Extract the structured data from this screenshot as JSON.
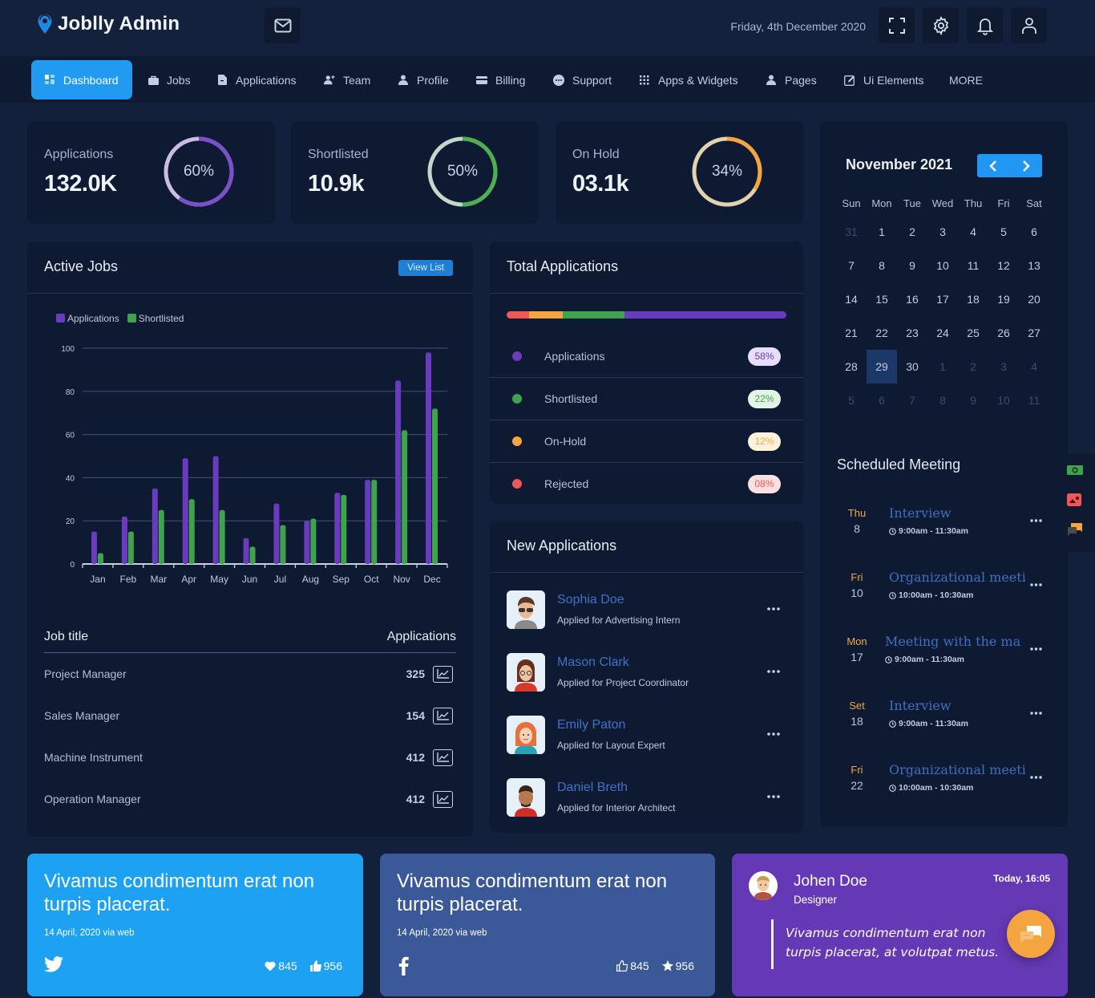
{
  "header": {
    "app_title": "Joblly Admin",
    "date": "Friday, 4th December 2020",
    "icons": [
      "mail-icon",
      "fullscreen-icon",
      "settings-icon",
      "bell-icon",
      "user-icon"
    ]
  },
  "nav": {
    "items": [
      {
        "label": "Dashboard",
        "icon": "dashboard-icon",
        "active": true
      },
      {
        "label": "Jobs",
        "icon": "briefcase-icon"
      },
      {
        "label": "Applications",
        "icon": "document-icon"
      },
      {
        "label": "Team",
        "icon": "add-user-icon"
      },
      {
        "label": "Profile",
        "icon": "person-icon"
      },
      {
        "label": "Billing",
        "icon": "credit-card-icon"
      },
      {
        "label": "Support",
        "icon": "chat-bubble-icon"
      },
      {
        "label": "Apps & Widgets",
        "icon": "grid-icon"
      },
      {
        "label": "Pages",
        "icon": "person-icon"
      },
      {
        "label": "Ui Elements",
        "icon": "edit-icon"
      },
      {
        "label": "MORE"
      }
    ]
  },
  "stats": [
    {
      "label": "Applications",
      "value": "132.0K",
      "percent_text": "60%",
      "percent": 60,
      "color": "#7b4fc9",
      "track": "#c9bde6"
    },
    {
      "label": "Shortlisted",
      "value": "10.9k",
      "percent_text": "50%",
      "percent": 50,
      "color": "#4caf50",
      "track": "#c6d6cb"
    },
    {
      "label": "On Hold",
      "value": "03.1k",
      "percent_text": "34%",
      "percent": 34,
      "color": "#f5a540",
      "track": "#e3d2b0"
    }
  ],
  "active_jobs": {
    "title": "Active Jobs",
    "view_list_label": "View List",
    "table": {
      "headers": [
        "Job title",
        "Applications"
      ],
      "rows": [
        {
          "title": "Project Manager",
          "count": "325"
        },
        {
          "title": "Sales Manager",
          "count": "154"
        },
        {
          "title": "Machine Instrument",
          "count": "412"
        },
        {
          "title": "Operation Manager",
          "count": "412"
        }
      ]
    }
  },
  "chart_data": {
    "type": "bar",
    "title": "",
    "xlabel": "",
    "ylabel": "",
    "categories": [
      "Jan",
      "Feb",
      "Mar",
      "Apr",
      "May",
      "Jun",
      "Jul",
      "Aug",
      "Sep",
      "Oct",
      "Nov",
      "Dec"
    ],
    "series": [
      {
        "name": "Applications",
        "color": "#6a3bbf",
        "values": [
          15,
          22,
          35,
          49,
          50,
          12,
          28,
          20,
          33,
          39,
          85,
          98
        ]
      },
      {
        "name": "Shortlisted",
        "color": "#3fa34d",
        "values": [
          5,
          15,
          25,
          30,
          25,
          8,
          18,
          21,
          32,
          39,
          62,
          72
        ]
      }
    ],
    "ylim": [
      0,
      100
    ],
    "yticks": [
      0,
      20,
      40,
      60,
      80,
      100
    ],
    "grid": true,
    "legend": "top-left"
  },
  "total_applications": {
    "title": "Total Applications",
    "segments_order": [
      "Rejected",
      "On-Hold",
      "Shortlisted",
      "Applications"
    ],
    "items": [
      {
        "label": "Applications",
        "badge": "58%",
        "percent": 58,
        "color": "#6a3bbf",
        "badge_bg": "#e6defb",
        "badge_fg": "#6a3bbf"
      },
      {
        "label": "Shortlisted",
        "badge": "22%",
        "percent": 22,
        "color": "#3fa34d",
        "badge_bg": "#e3f5e6",
        "badge_fg": "#3fa34d"
      },
      {
        "label": "On-Hold",
        "badge": "12%",
        "percent": 12,
        "color": "#f5a540",
        "badge_bg": "#fdf2de",
        "badge_fg": "#f5a540"
      },
      {
        "label": "Rejected",
        "badge": "08%",
        "percent": 8,
        "color": "#f25757",
        "badge_bg": "#fde0e0",
        "badge_fg": "#f25757"
      }
    ]
  },
  "new_applications": {
    "title": "New Applications",
    "items": [
      {
        "name": "Sophia Doe",
        "applied_for": "Applied for Advertising Intern"
      },
      {
        "name": "Mason Clark",
        "applied_for": "Applied for Project Coordinator"
      },
      {
        "name": "Emily Paton",
        "applied_for": "Applied for Layout Expert"
      },
      {
        "name": "Daniel Breth",
        "applied_for": "Applied for Interior Architect"
      }
    ]
  },
  "calendar": {
    "title": "November 2021",
    "weekdays": [
      "Sun",
      "Mon",
      "Tue",
      "Wed",
      "Thu",
      "Fri",
      "Sat"
    ],
    "weeks": [
      [
        {
          "d": "31",
          "m": true
        },
        {
          "d": "1"
        },
        {
          "d": "2"
        },
        {
          "d": "3"
        },
        {
          "d": "4"
        },
        {
          "d": "5"
        },
        {
          "d": "6"
        }
      ],
      [
        {
          "d": "7"
        },
        {
          "d": "8"
        },
        {
          "d": "9"
        },
        {
          "d": "10"
        },
        {
          "d": "11"
        },
        {
          "d": "12"
        },
        {
          "d": "13"
        }
      ],
      [
        {
          "d": "14"
        },
        {
          "d": "15"
        },
        {
          "d": "16"
        },
        {
          "d": "17"
        },
        {
          "d": "18"
        },
        {
          "d": "19"
        },
        {
          "d": "20"
        }
      ],
      [
        {
          "d": "21"
        },
        {
          "d": "22"
        },
        {
          "d": "23"
        },
        {
          "d": "24"
        },
        {
          "d": "25"
        },
        {
          "d": "26"
        },
        {
          "d": "27"
        }
      ],
      [
        {
          "d": "28"
        },
        {
          "d": "29",
          "sel": true
        },
        {
          "d": "30"
        },
        {
          "d": "1",
          "m": true
        },
        {
          "d": "2",
          "m": true
        },
        {
          "d": "3",
          "m": true
        },
        {
          "d": "4",
          "m": true
        }
      ],
      [
        {
          "d": "5",
          "m": true
        },
        {
          "d": "6",
          "m": true
        },
        {
          "d": "7",
          "m": true
        },
        {
          "d": "8",
          "m": true
        },
        {
          "d": "9",
          "m": true
        },
        {
          "d": "10",
          "m": true
        },
        {
          "d": "11",
          "m": true
        }
      ]
    ]
  },
  "scheduled": {
    "title": "Scheduled Meeting",
    "items": [
      {
        "dow": "Thu",
        "day": "8",
        "title": "Interview",
        "time": "9:00am - 11:30am"
      },
      {
        "dow": "Fri",
        "day": "10",
        "title": "Organizational meeting",
        "time": "10:00am - 10:30am"
      },
      {
        "dow": "Mon",
        "day": "17",
        "title": "Meeting with the manager",
        "time": "9:00am - 11:30am"
      },
      {
        "dow": "Set",
        "day": "18",
        "title": "Interview",
        "time": "9:00am - 11:30am"
      },
      {
        "dow": "Fri",
        "day": "22",
        "title": "Organizational meeting",
        "time": "10:00am - 10:30am"
      }
    ]
  },
  "side_tools": [
    "camera-icon",
    "image-icon",
    "chat-icon"
  ],
  "posts": [
    {
      "text": "Vivamus condimentum erat non turpis placerat.",
      "date": "14 April, 2020 via web",
      "network": "twitter-icon",
      "stat1": "845",
      "stat1_icon": "heart-icon",
      "stat2": "956",
      "stat2_icon": "thumbs-up-icon",
      "bg": "#1da1f2"
    },
    {
      "text": "Vivamus condimentum erat non turpis placerat.",
      "date": "14 April, 2020 via web",
      "network": "facebook-icon",
      "stat1": "845",
      "stat1_icon": "thumbs-up-outline-icon",
      "stat2": "956",
      "stat2_icon": "star-icon",
      "bg": "#3b5998"
    }
  ],
  "testimonial": {
    "name": "Johen Doe",
    "role": "Designer",
    "time": "Today, 16:05",
    "quote": "Vivamus condimentum erat non turpis placerat, at volutpat metus.",
    "bg": "#6539b5"
  }
}
